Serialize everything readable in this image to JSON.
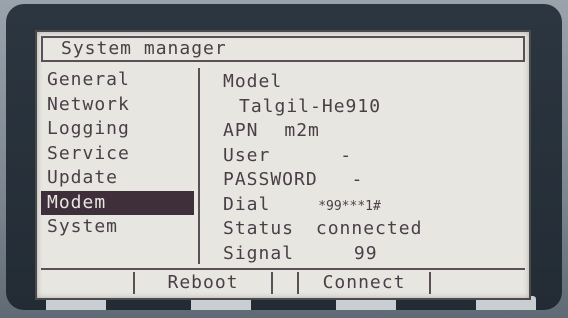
{
  "header": {
    "title": "System manager"
  },
  "menu": {
    "items": [
      {
        "label": "General"
      },
      {
        "label": "Network"
      },
      {
        "label": "Logging"
      },
      {
        "label": "Service"
      },
      {
        "label": "Update"
      },
      {
        "label": "Modem"
      },
      {
        "label": "System"
      }
    ],
    "selected": "Modem"
  },
  "details": {
    "model_label": "Model",
    "model_value": "Talgil-He910",
    "apn_label": "APN",
    "apn_value": "m2m",
    "user_label": "User",
    "user_value": "-",
    "password_label": "PASSWORD",
    "password_value": "-",
    "dial_label": "Dial",
    "dial_value": "*99***1#",
    "status_label": "Status",
    "status_value": "connected",
    "signal_label": "Signal",
    "signal_value": "99"
  },
  "softkeys": {
    "reboot": "Reboot",
    "connect": "Connect"
  },
  "colors": {
    "lcd_background": "#e7e6e1",
    "lcd_text": "#4a3f47",
    "selection": "#3f2f3b"
  }
}
